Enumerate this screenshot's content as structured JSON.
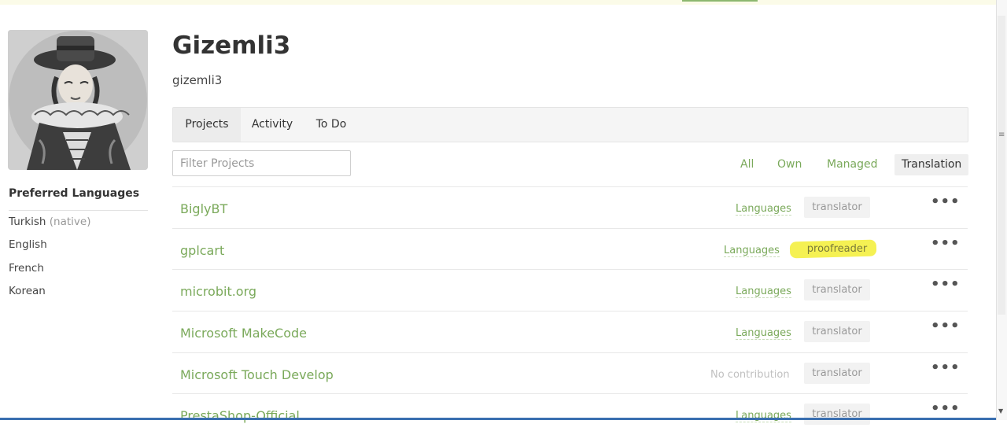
{
  "user": {
    "display_name": "Gizemli3",
    "username": "gizemli3"
  },
  "preferred_languages": {
    "title": "Preferred Languages",
    "items": [
      {
        "name": "Turkish",
        "note": "(native)"
      },
      {
        "name": "English",
        "note": ""
      },
      {
        "name": "French",
        "note": ""
      },
      {
        "name": "Korean",
        "note": ""
      }
    ]
  },
  "tabs": [
    {
      "label": "Projects",
      "active": true
    },
    {
      "label": "Activity",
      "active": false
    },
    {
      "label": "To Do",
      "active": false
    }
  ],
  "filter": {
    "placeholder": "Filter Projects",
    "value": ""
  },
  "filters": [
    {
      "label": "All",
      "active": false
    },
    {
      "label": "Own",
      "active": false
    },
    {
      "label": "Managed",
      "active": false
    },
    {
      "label": "Translation",
      "active": true
    }
  ],
  "projects": [
    {
      "name": "BiglyBT",
      "link": "Languages",
      "role": "translator",
      "highlighted": false
    },
    {
      "name": "gplcart",
      "link": "Languages",
      "role": "proofreader",
      "highlighted": true
    },
    {
      "name": "microbit.org",
      "link": "Languages",
      "role": "translator",
      "highlighted": false
    },
    {
      "name": "Microsoft MakeCode",
      "link": "Languages",
      "role": "translator",
      "highlighted": false
    },
    {
      "name": "Microsoft Touch Develop",
      "link": "No contribution",
      "role": "translator",
      "highlighted": false
    },
    {
      "name": "PrestaShop-Official",
      "link": "Languages",
      "role": "translator",
      "highlighted": false
    }
  ],
  "icons": {
    "more": "more-options-icon"
  },
  "colors": {
    "accent": "#7aa95a",
    "highlight": "#f4f04a"
  }
}
